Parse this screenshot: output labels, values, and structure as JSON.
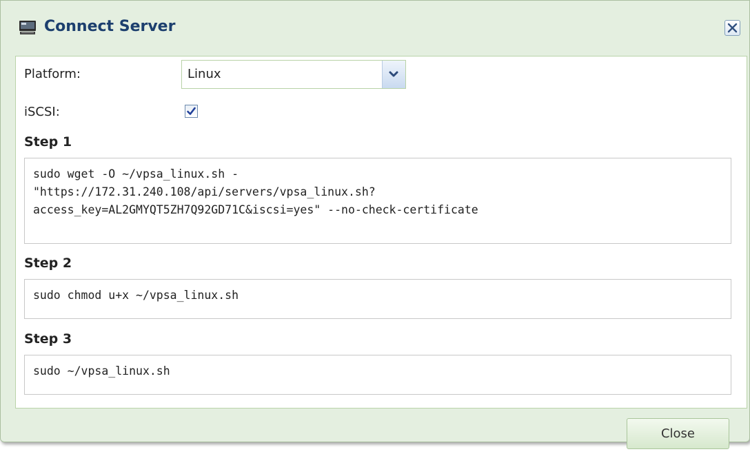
{
  "dialog": {
    "title": "Connect Server",
    "title_icon": "monitor-icon",
    "close_icon": "close-icon"
  },
  "form": {
    "platform_label": "Platform:",
    "platform_value": "Linux",
    "iscsi_label": "iSCSI:",
    "iscsi_checked": true
  },
  "steps": [
    {
      "title": "Step 1",
      "command": "sudo wget -O ~/vpsa_linux.sh -\n\"https://172.31.240.108/api/servers/vpsa_linux.sh?\naccess_key=AL2GMYQT5ZH7Q92GD71C&iscsi=yes\" --no-check-certificate"
    },
    {
      "title": "Step 2",
      "command": "sudo chmod u+x ~/vpsa_linux.sh"
    },
    {
      "title": "Step 3",
      "command": "sudo ~/vpsa_linux.sh"
    }
  ],
  "footer": {
    "close_label": "Close"
  },
  "colors": {
    "title": "#1c3f6e",
    "dialog_bg": "#e4efe0",
    "panel_border": "#b9d3a8"
  }
}
